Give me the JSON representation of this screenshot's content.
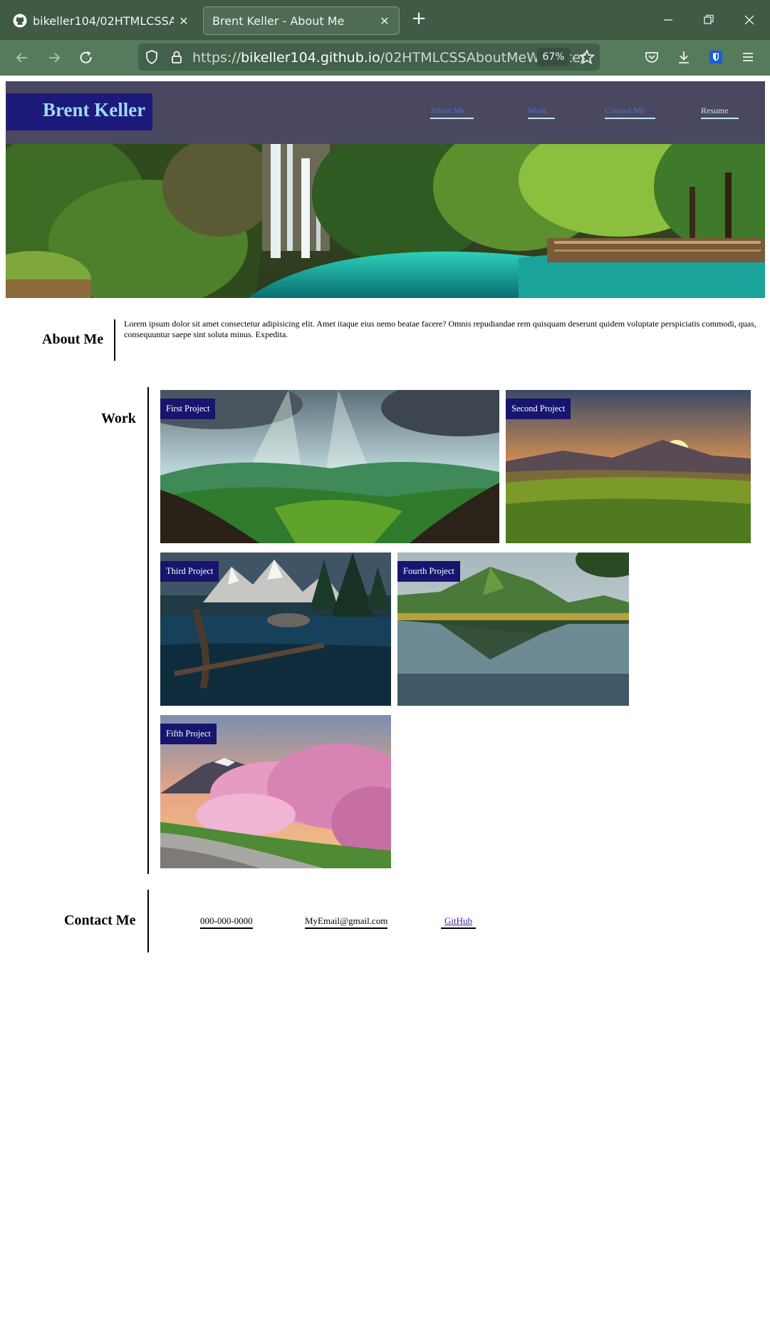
{
  "browser": {
    "tabs": [
      {
        "title": "bikeller104/02HTMLCSSAboutMe",
        "icon": "github-icon",
        "active": false
      },
      {
        "title": "Brent Keller - About Me",
        "active": true
      }
    ],
    "url_scheme": "https://",
    "url_host": "bikeller104.github.io",
    "url_path": "/02HTMLCSSAboutMeWebsite/",
    "zoom": "67%"
  },
  "site": {
    "name": "Brent Keller",
    "nav": [
      {
        "label": "About Me"
      },
      {
        "label": "Work"
      },
      {
        "label": "Contact Me"
      },
      {
        "label": "Resume"
      }
    ],
    "hero_icon": "waterfall-lagoon-image"
  },
  "about": {
    "heading": "About Me",
    "text": "Lorem ipsum dolor sit amet consectetur adipisicing elit. Amet itaque eius nemo beatae facere? Omnis repudiandae rem quisquam deserunt quidem voluptate perspiciatis commodi, quas, consequuntur saepe sint soluta minus. Expedita."
  },
  "work": {
    "heading": "Work",
    "projects": [
      {
        "label": "First Project",
        "image": "mountain-valley-sunrays-image"
      },
      {
        "label": "Second Project",
        "image": "sunset-meadow-image"
      },
      {
        "label": "Third Project",
        "image": "alpine-lake-driftwood-image"
      },
      {
        "label": "Fourth Project",
        "image": "lake-reflection-mountain-image"
      },
      {
        "label": "Fifth Project",
        "image": "fuji-cherry-blossom-image"
      }
    ]
  },
  "contact": {
    "heading": "Contact Me",
    "phone": "000-000-0000",
    "email": "MyEmail@gmail.com",
    "github": "GitHub"
  },
  "colors": {
    "tab_bar": "#3f5a45",
    "toolbar": "#557a5c",
    "header_bg": "#4a4860",
    "logo_bg": "#1b1a7a",
    "logo_text": "#9fd8ff",
    "label_bg": "#17156e"
  }
}
